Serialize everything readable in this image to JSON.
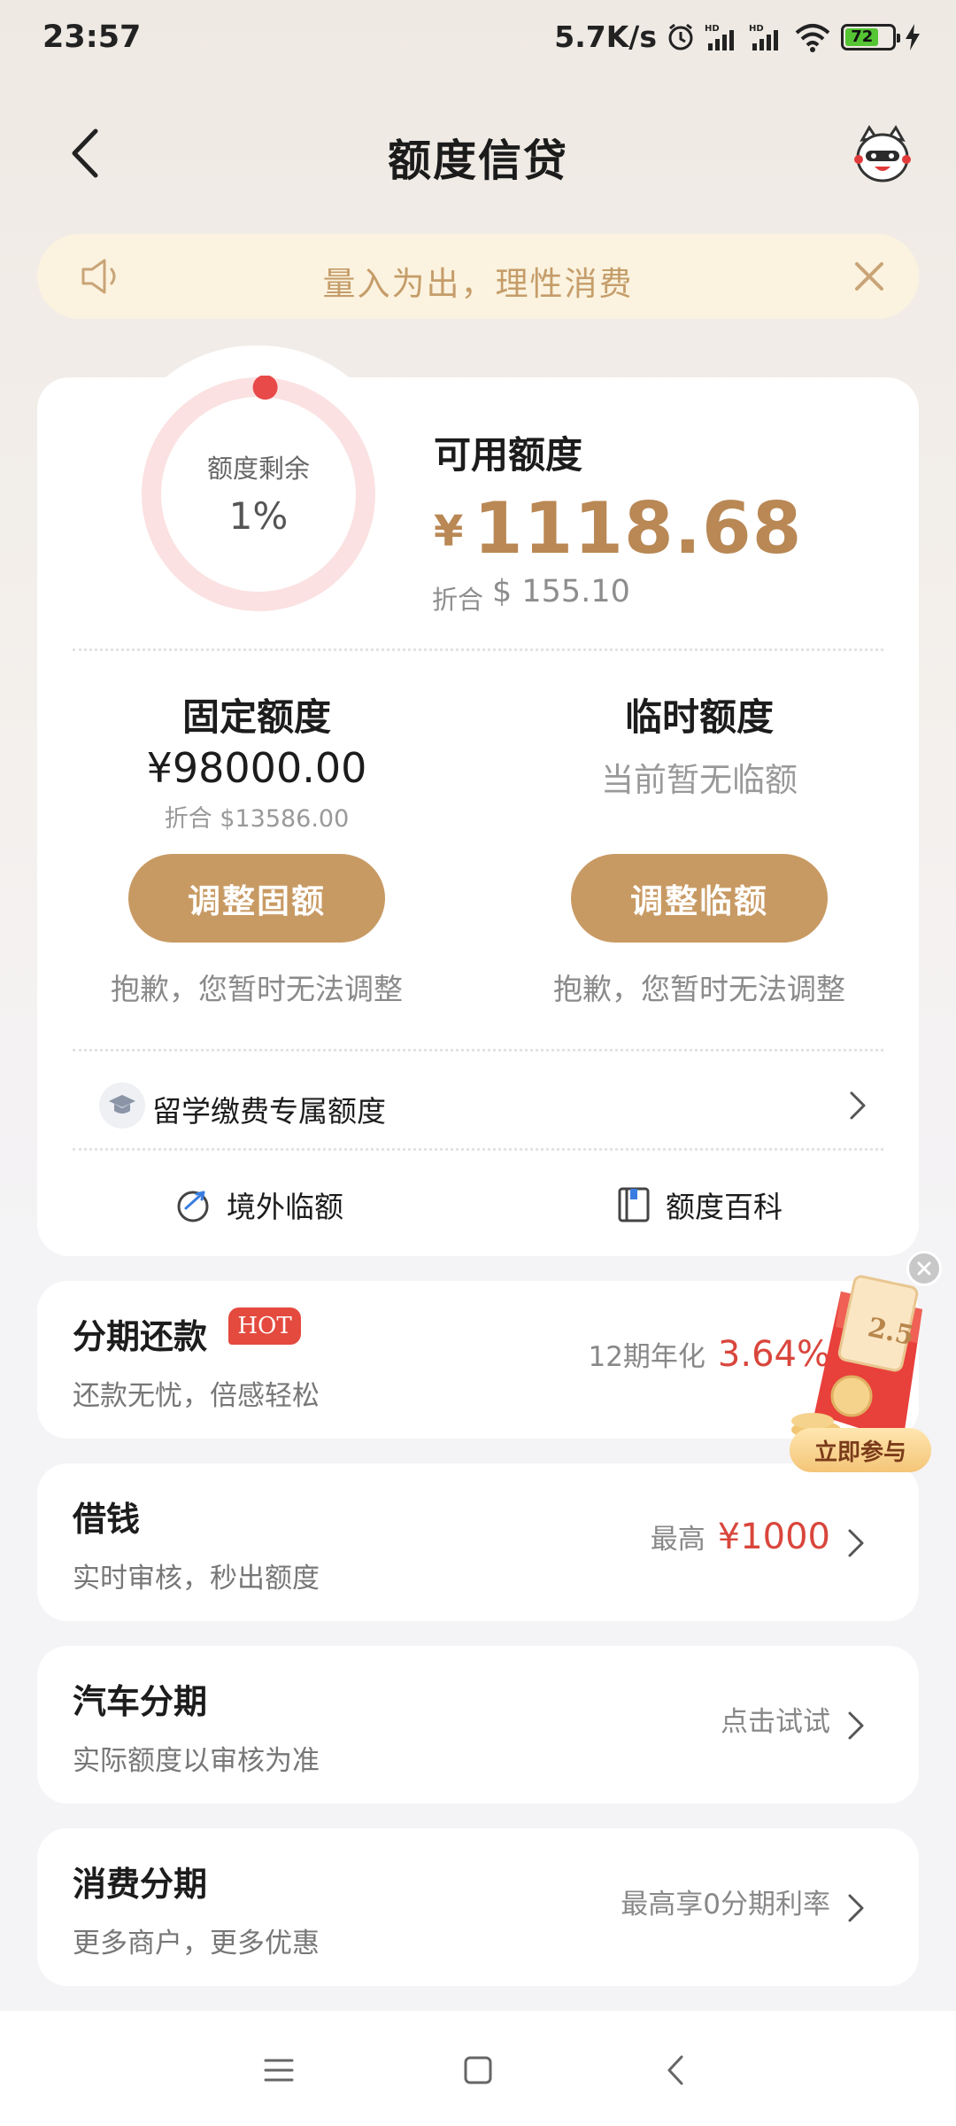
{
  "status_bar": {
    "time": "23:57",
    "speed": "5.7K/s",
    "battery": "72"
  },
  "nav": {
    "title": "额度信贷"
  },
  "notice": {
    "text": "量入为出，理性消费"
  },
  "credit": {
    "ring_label": "额度剩余",
    "ring_percent": "1%",
    "ring_fraction": 0.01,
    "available_label": "可用额度",
    "currency_symbol": "¥",
    "available_amount": "1118.68",
    "converted_prefix": "折合",
    "converted_amount": "$ 155.10",
    "fixed": {
      "title": "固定额度",
      "amount": "¥98000.00",
      "converted": "折合 $13586.00",
      "button": "调整固额",
      "note": "抱歉，您暂时无法调整"
    },
    "temporary": {
      "title": "临时额度",
      "status": "当前暂无临额",
      "button": "调整临额",
      "note": "抱歉，您暂时无法调整"
    },
    "study_abroad": "留学缴费专属额度",
    "links": {
      "overseas": "境外临额",
      "encyclopedia": "额度百科"
    }
  },
  "features": [
    {
      "title": "分期还款",
      "badge": "HOT",
      "subtitle": "还款无忧，倍感轻松",
      "right_prefix": "12期年化",
      "right_value": "3.64%"
    },
    {
      "title": "借钱",
      "subtitle": "实时审核，秒出额度",
      "right_prefix": "最高",
      "right_value": "¥1000"
    },
    {
      "title": "汽车分期",
      "subtitle": "实际额度以审核为准",
      "right_text": "点击试试"
    },
    {
      "title": "消费分期",
      "subtitle": "更多商户，更多优惠",
      "right_text": "最高享0分期利率"
    }
  ],
  "promo": {
    "label": "立即参与",
    "badge": "2.5"
  },
  "colors": {
    "accent": "#c89a63",
    "amount": "#b98855",
    "highlight_red": "#d9463c",
    "ring_track": "#fbe1e1",
    "ring_dot": "#e84a4a"
  }
}
